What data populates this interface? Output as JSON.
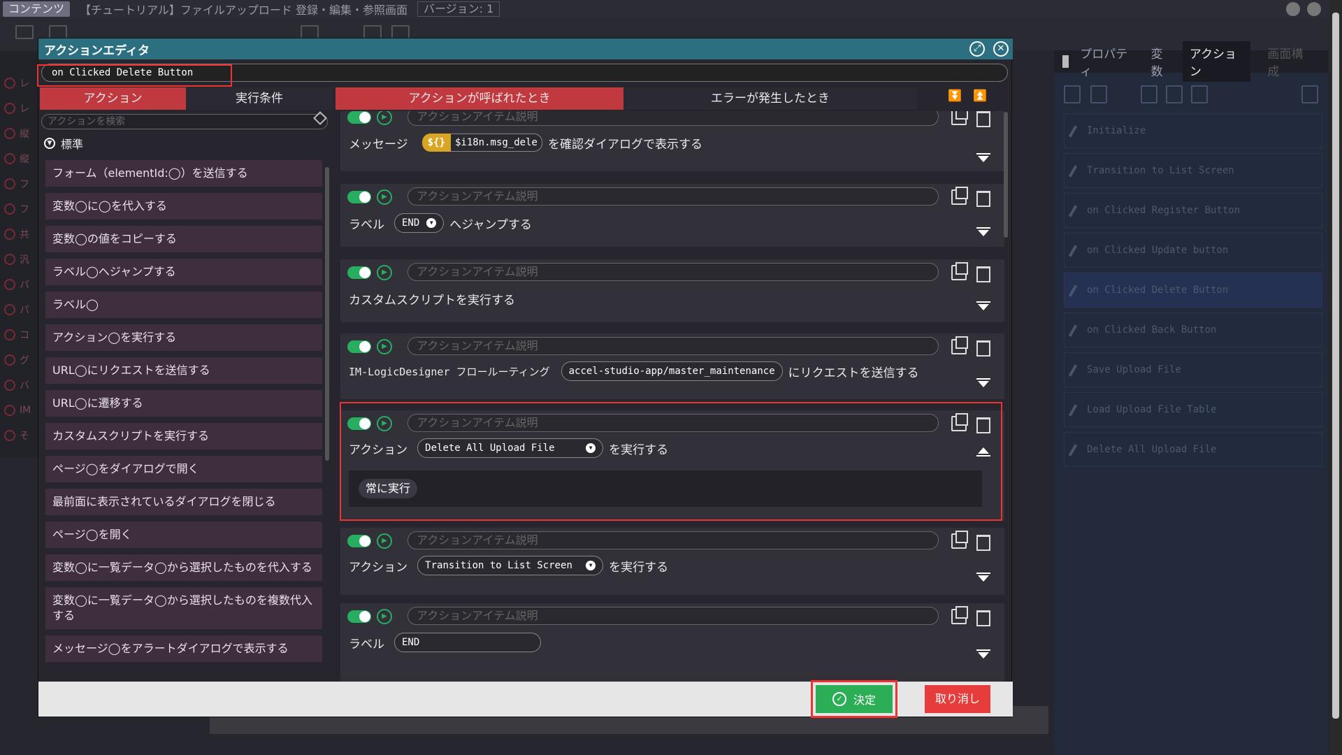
{
  "topbar": {
    "content_tab": "コンテンツ",
    "title": "【チュートリアル】ファイルアップロード 登録・編集・参照画面",
    "version": "バージョン: 1"
  },
  "right_panel": {
    "tabs": [
      "プロパティ",
      "変数",
      "アクション",
      "画面構成"
    ],
    "items": [
      "Initialize",
      "Transition to List Screen",
      "on Clicked Register Button",
      "on Clicked Update button",
      "on Clicked Delete Button",
      "on Clicked Back Button",
      "Save Upload File",
      "Load Upload File Table",
      "Delete All Upload File"
    ]
  },
  "dialog": {
    "title": "アクションエディタ",
    "event_name": "on Clicked Delete Button",
    "tabs": {
      "action": "アクション",
      "condition": "実行条件",
      "called": "アクションが呼ばれたとき",
      "error": "エラーが発生したとき"
    },
    "search_placeholder": "アクションを検索",
    "category": "標準",
    "library": [
      "フォーム（elementId:◯）を送信する",
      "変数◯に◯を代入する",
      "変数◯の値をコピーする",
      "ラベル◯へジャンプする",
      "ラベル◯",
      "アクション◯を実行する",
      "URL◯にリクエストを送信する",
      "URL◯に遷移する",
      "カスタムスクリプトを実行する",
      "ページ◯をダイアログで開く",
      "最前面に表示されているダイアログを閉じる",
      "ページ◯を開く",
      "変数◯に一覧データ◯から選択したものを代入する",
      "変数◯に一覧データ◯から選択したものを複数代入する",
      "メッセージ◯をアラートダイアログで表示する"
    ],
    "desc_placeholder": "アクションアイテム説明",
    "cards": {
      "msg": {
        "label": "メッセージ",
        "chip": "${}",
        "var": "$i18n.msg_dele",
        "suffix": "を確認ダイアログで表示する"
      },
      "jump": {
        "label": "ラベル",
        "value": "END",
        "suffix": "へジャンプする"
      },
      "script": {
        "text": "カスタムスクリプトを実行する"
      },
      "logic": {
        "prefix": "IM-LogicDesigner フロールーティング",
        "value": "accel-studio-app/master_maintenance",
        "suffix": "にリクエストを送信する"
      },
      "exec1": {
        "label": "アクション",
        "value": "Delete All Upload File",
        "suffix": "を実行する",
        "run": "常に実行"
      },
      "exec2": {
        "label": "アクション",
        "value": "Transition to List Screen",
        "suffix": "を実行する"
      },
      "lbl": {
        "label": "ラベル",
        "value": "END"
      }
    },
    "ok_label": "決定",
    "cancel_label": "取り消し"
  }
}
